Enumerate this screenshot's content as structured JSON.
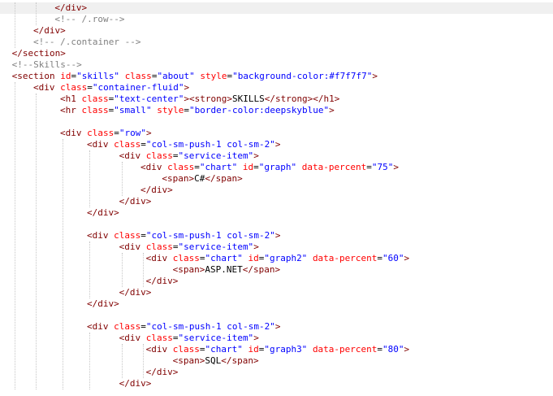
{
  "editor": {
    "highlighted_line": 0,
    "lines": [
      {
        "indent": 9,
        "tokens": [
          {
            "k": "tag",
            "t": "</div>"
          }
        ]
      },
      {
        "indent": 9,
        "tokens": [
          {
            "k": "cmt",
            "t": "<!-- /.row-->"
          }
        ]
      },
      {
        "indent": 5,
        "tokens": [
          {
            "k": "tag",
            "t": "</div>"
          }
        ]
      },
      {
        "indent": 5,
        "tokens": [
          {
            "k": "cmt",
            "t": "<!-- /.container -->"
          }
        ]
      },
      {
        "indent": 1,
        "tokens": [
          {
            "k": "tag",
            "t": "</section>"
          }
        ]
      },
      {
        "indent": 1,
        "tokens": [
          {
            "k": "cmt",
            "t": "<!--Skills-->"
          }
        ]
      },
      {
        "indent": 1,
        "tokens": [
          {
            "k": "tag",
            "t": "<section "
          },
          {
            "k": "attr",
            "t": "id"
          },
          {
            "k": "txt",
            "t": "="
          },
          {
            "k": "val",
            "t": "\"skills\" "
          },
          {
            "k": "attr",
            "t": "class"
          },
          {
            "k": "txt",
            "t": "="
          },
          {
            "k": "val",
            "t": "\"about\" "
          },
          {
            "k": "attr",
            "t": "style"
          },
          {
            "k": "txt",
            "t": "="
          },
          {
            "k": "val",
            "t": "\"background-color:#f7f7f7\""
          },
          {
            "k": "tag",
            "t": ">"
          }
        ]
      },
      {
        "indent": 5,
        "tokens": [
          {
            "k": "tag",
            "t": "<div "
          },
          {
            "k": "attr",
            "t": "class"
          },
          {
            "k": "txt",
            "t": "="
          },
          {
            "k": "val",
            "t": "\"container-fluid\""
          },
          {
            "k": "tag",
            "t": ">"
          }
        ]
      },
      {
        "indent": 10,
        "tokens": [
          {
            "k": "tag",
            "t": "<h1 "
          },
          {
            "k": "attr",
            "t": "class"
          },
          {
            "k": "txt",
            "t": "="
          },
          {
            "k": "val",
            "t": "\"text-center\""
          },
          {
            "k": "tag",
            "t": "><strong>"
          },
          {
            "k": "txt",
            "t": "SKILLS"
          },
          {
            "k": "tag",
            "t": "</strong></h1>"
          }
        ]
      },
      {
        "indent": 10,
        "tokens": [
          {
            "k": "tag",
            "t": "<hr "
          },
          {
            "k": "attr",
            "t": "class"
          },
          {
            "k": "txt",
            "t": "="
          },
          {
            "k": "val",
            "t": "\"small\" "
          },
          {
            "k": "attr",
            "t": "style"
          },
          {
            "k": "txt",
            "t": "="
          },
          {
            "k": "val",
            "t": "\"border-color:deepskyblue\""
          },
          {
            "k": "tag",
            "t": ">"
          }
        ]
      },
      {
        "indent": 0,
        "tokens": []
      },
      {
        "indent": 10,
        "tokens": [
          {
            "k": "tag",
            "t": "<div "
          },
          {
            "k": "attr",
            "t": "class"
          },
          {
            "k": "txt",
            "t": "="
          },
          {
            "k": "val",
            "t": "\"row\""
          },
          {
            "k": "tag",
            "t": ">"
          }
        ]
      },
      {
        "indent": 15,
        "tokens": [
          {
            "k": "tag",
            "t": "<div "
          },
          {
            "k": "attr",
            "t": "class"
          },
          {
            "k": "txt",
            "t": "="
          },
          {
            "k": "val",
            "t": "\"col-sm-push-1 col-sm-2\""
          },
          {
            "k": "tag",
            "t": ">"
          }
        ]
      },
      {
        "indent": 21,
        "tokens": [
          {
            "k": "tag",
            "t": "<div "
          },
          {
            "k": "attr",
            "t": "class"
          },
          {
            "k": "txt",
            "t": "="
          },
          {
            "k": "val",
            "t": "\"service-item\""
          },
          {
            "k": "tag",
            "t": ">"
          }
        ]
      },
      {
        "indent": 25,
        "tokens": [
          {
            "k": "tag",
            "t": "<div "
          },
          {
            "k": "attr",
            "t": "class"
          },
          {
            "k": "txt",
            "t": "="
          },
          {
            "k": "val",
            "t": "\"chart\" "
          },
          {
            "k": "attr",
            "t": "id"
          },
          {
            "k": "txt",
            "t": "="
          },
          {
            "k": "val",
            "t": "\"graph\" "
          },
          {
            "k": "attr",
            "t": "data-percent"
          },
          {
            "k": "txt",
            "t": "="
          },
          {
            "k": "val",
            "t": "\"75\""
          },
          {
            "k": "tag",
            "t": ">"
          }
        ]
      },
      {
        "indent": 29,
        "tokens": [
          {
            "k": "tag",
            "t": "<span>"
          },
          {
            "k": "txt",
            "t": "C#"
          },
          {
            "k": "tag",
            "t": "</span>"
          }
        ]
      },
      {
        "indent": 25,
        "tokens": [
          {
            "k": "tag",
            "t": "</div>"
          }
        ]
      },
      {
        "indent": 21,
        "tokens": [
          {
            "k": "tag",
            "t": "</div>"
          }
        ]
      },
      {
        "indent": 15,
        "tokens": [
          {
            "k": "tag",
            "t": "</div>"
          }
        ]
      },
      {
        "indent": 0,
        "tokens": []
      },
      {
        "indent": 15,
        "tokens": [
          {
            "k": "tag",
            "t": "<div "
          },
          {
            "k": "attr",
            "t": "class"
          },
          {
            "k": "txt",
            "t": "="
          },
          {
            "k": "val",
            "t": "\"col-sm-push-1 col-sm-2\""
          },
          {
            "k": "tag",
            "t": ">"
          }
        ]
      },
      {
        "indent": 21,
        "tokens": [
          {
            "k": "tag",
            "t": "<div "
          },
          {
            "k": "attr",
            "t": "class"
          },
          {
            "k": "txt",
            "t": "="
          },
          {
            "k": "val",
            "t": "\"service-item\""
          },
          {
            "k": "tag",
            "t": ">"
          }
        ]
      },
      {
        "indent": 26,
        "tokens": [
          {
            "k": "tag",
            "t": "<div "
          },
          {
            "k": "attr",
            "t": "class"
          },
          {
            "k": "txt",
            "t": "="
          },
          {
            "k": "val",
            "t": "\"chart\" "
          },
          {
            "k": "attr",
            "t": "id"
          },
          {
            "k": "txt",
            "t": "="
          },
          {
            "k": "val",
            "t": "\"graph2\" "
          },
          {
            "k": "attr",
            "t": "data-percent"
          },
          {
            "k": "txt",
            "t": "="
          },
          {
            "k": "val",
            "t": "\"60\""
          },
          {
            "k": "tag",
            "t": ">"
          }
        ]
      },
      {
        "indent": 31,
        "tokens": [
          {
            "k": "tag",
            "t": "<span>"
          },
          {
            "k": "txt",
            "t": "ASP.NET"
          },
          {
            "k": "tag",
            "t": "</span>"
          }
        ]
      },
      {
        "indent": 26,
        "tokens": [
          {
            "k": "tag",
            "t": "</div>"
          }
        ]
      },
      {
        "indent": 21,
        "tokens": [
          {
            "k": "tag",
            "t": "</div>"
          }
        ]
      },
      {
        "indent": 15,
        "tokens": [
          {
            "k": "tag",
            "t": "</div>"
          }
        ]
      },
      {
        "indent": 0,
        "tokens": []
      },
      {
        "indent": 15,
        "tokens": [
          {
            "k": "tag",
            "t": "<div "
          },
          {
            "k": "attr",
            "t": "class"
          },
          {
            "k": "txt",
            "t": "="
          },
          {
            "k": "val",
            "t": "\"col-sm-push-1 col-sm-2\""
          },
          {
            "k": "tag",
            "t": ">"
          }
        ]
      },
      {
        "indent": 21,
        "tokens": [
          {
            "k": "tag",
            "t": "<div "
          },
          {
            "k": "attr",
            "t": "class"
          },
          {
            "k": "txt",
            "t": "="
          },
          {
            "k": "val",
            "t": "\"service-item\""
          },
          {
            "k": "tag",
            "t": ">"
          }
        ]
      },
      {
        "indent": 26,
        "tokens": [
          {
            "k": "tag",
            "t": "<div "
          },
          {
            "k": "attr",
            "t": "class"
          },
          {
            "k": "txt",
            "t": "="
          },
          {
            "k": "val",
            "t": "\"chart\" "
          },
          {
            "k": "attr",
            "t": "id"
          },
          {
            "k": "txt",
            "t": "="
          },
          {
            "k": "val",
            "t": "\"graph3\" "
          },
          {
            "k": "attr",
            "t": "data-percent"
          },
          {
            "k": "txt",
            "t": "="
          },
          {
            "k": "val",
            "t": "\"80\""
          },
          {
            "k": "tag",
            "t": ">"
          }
        ]
      },
      {
        "indent": 31,
        "tokens": [
          {
            "k": "tag",
            "t": "<span>"
          },
          {
            "k": "txt",
            "t": "SQL"
          },
          {
            "k": "tag",
            "t": "</span>"
          }
        ]
      },
      {
        "indent": 26,
        "tokens": [
          {
            "k": "tag",
            "t": "</div>"
          }
        ]
      },
      {
        "indent": 21,
        "tokens": [
          {
            "k": "tag",
            "t": "</div>"
          }
        ]
      }
    ]
  }
}
